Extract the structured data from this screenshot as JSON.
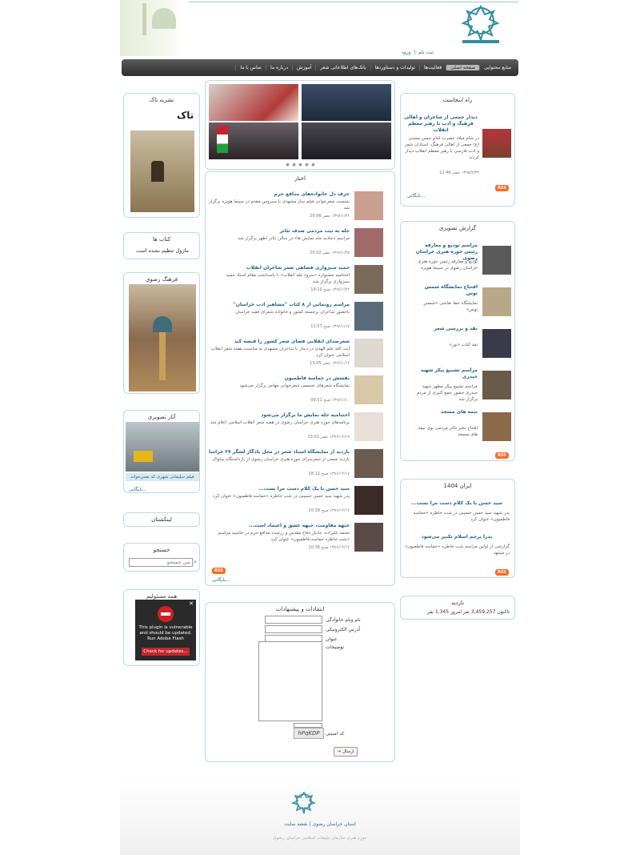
{
  "header": {
    "logo": "logo-icon",
    "login": "ورود",
    "register": "ثبت نام",
    "separator": "|"
  },
  "nav": [
    {
      "label": "منابع محتوایی",
      "active": false
    },
    {
      "label": "صفحه اصلی",
      "active": true
    },
    {
      "label": "فعالیت‌ها",
      "active": false
    },
    {
      "label": "تولیدات و دستاوردها",
      "active": false
    },
    {
      "label": "بانک‌های اطلاعاتی شعر",
      "active": false
    },
    {
      "label": "آموزش",
      "active": false
    },
    {
      "label": "درباره ما",
      "active": false
    },
    {
      "label": "تماس با ما",
      "active": false
    }
  ],
  "left": {
    "nashriyeh_title": "نشریه تاک",
    "books_title": "کتاب ها",
    "books_empty": "ماژول تنظیم نشده است",
    "farhang_title": "فرهنگ رضوی",
    "asar_title": "آثار تصویری",
    "asar_caption": "فیلم سلیمانی شهری که نفس‌خواند",
    "asar_more": "بایگانی...",
    "links_title": "لینکستان",
    "search_title": "جستجو",
    "search_placeholder": "متن جستجو",
    "poll_title": "همه مسئولیم",
    "flash_line1": "This plugin is vulnerable",
    "flash_line2": "and should be updated.",
    "flash_line3": "Run Adobe Flash",
    "flash_button": "Check for updates..."
  },
  "center": {
    "news_title": "اخبار",
    "news": [
      {
        "title": "حرف دل خانواده‌های مدافع حرم",
        "desc": "نشست شعرخوانی فیلم ساز مشهدی با سیروس مقدم در سینما هویزه برگزار شد",
        "date": "۱۳۹۶/۱/۲۶ عصر 20:06"
      },
      {
        "title": "جله به نیت مردمی صدف تئاتر",
        "desc": "مراسم «جاذبه جله نمایش ها» در سالن تئاتر اطهر برگزار شد",
        "date": "۱۳۹۶/۱/۲۵ عصر 20:02"
      },
      {
        "title": "حمید سبزواری فضاهی شعر شاعران انقلاب",
        "desc": "اختتامیه جشنواره «سرود جله انقلاب» با پاسداشت مقام استاد حمید سبزواری برگزار شد",
        "date": "۱۳۹۶/۱/۲۲ صبح 19:10"
      },
      {
        "title": "مراسم رونمایی از ۸ کتاب \"مشاهیر ادب خراسان\"",
        "desc": "باحضور شاعران برجسته کشور و خانواده شعرای فقید خراسان",
        "date": "۱۳۹۶/۱/۱۷ صبح 11:57"
      },
      {
        "title": "شعرصدای انقلابی فضای شعر کشور را قبضه کند",
        "desc": "آیت الله علم الهدی در دیدار با شاعران مشهدی به مناسبت هفته شعر انقلاب اسلامی عنوان کرد",
        "date": "۱۳۹۶/۱/۱۴ عصر 13:05"
      },
      {
        "title": "نقشش در حماسه فاطمیون",
        "desc": "نمایشگاه شعرهای تجسمی شعرخوانی مهاجر برگزار می‌شود",
        "date": "۱۳۹۶/۱/۱۰ صبح 09:51"
      },
      {
        "title": "اختتامیه جله نمایش ما برگزار می‌شود",
        "desc": "برنامه‌های حوزه هنری خراسان رضوی در هفته شعر انقلاب اسلامی اعلام شد",
        "date": "۱۳۹۶/۱۲/۱۹ عصر 13:01"
      },
      {
        "title": "بازدید از نمایشگاه اسناد شعر در محل یادگار لشگر ۲۷ خراسان",
        "desc": "بازدید جمعی از شعرسرای حوزه هنری خراسان رضوی از بازداشتگاه ساواک",
        "date": "۱۳۹۶/۱۲/۱۷ صبح 18:12"
      },
      {
        "title": "سید حسن با یک کلام دست مرا بست...",
        "desc": "پدر شهید سید حسن حسینی در شب خاطره «حماسه فاطمیون» عنوان کرد",
        "date": "۱۳۹۶/۱۲/۱۲ صبح 10:39"
      },
      {
        "title": "جبهه مقاومت، جبهه عشق و اعتماد است...",
        "desc": "محمد علیزاده، جانباز دفاع مقدس و رزمنده مدافع حرم در حاشیه مراسم «شب خاطره حماسه فاطمیون» عنوان کرد",
        "date": "۱۳۹۶/۱۲/۱۲ صبح 10:36"
      }
    ],
    "news_more": "بایگانی...",
    "rss": "RSS",
    "form_title": "انتقادات و پیشنهادات",
    "form_name": "نام ونام خانوادگی",
    "form_email": "آدرس الکترونیکی",
    "form_subject": "عنوان",
    "form_desc": "توضیحات",
    "form_captcha_label": "کد امنیتی",
    "form_captcha": "hPqKDP",
    "form_submit": "ارسال"
  },
  "right": {
    "rah_title": "راه ابنجاست",
    "rah_item_title": "دیدار جمعی از شاعران و اهالی فرهنگ و ادب با رهبر معظم انقلاب",
    "rah_item_desc": "در شام میلاد حضرت امام حسن مجتبی (ع) جمعی از اهالی فرهنگ، استادان شعر و ادب فارسی با رهبر معظم انقلاب دیدار کردند",
    "rah_item_date": "۱۳۹۵/۲/۳۲ عصر 12:46",
    "rah_more": "بایگانی...",
    "gozaresh_title": "گزارش تصویری",
    "gozaresh": [
      {
        "title": "مراسم تودیع و معارفه رئیس حوزه هنری خراسان رضوی",
        "desc": "تودیع و معارفه رئیس حوزه هنری خراسان رضوی در سینما هویزه"
      },
      {
        "title": "افتتاح نمایشگاه شمس توس",
        "desc": "نمایشگاه خط نقاشی «شمس توس»"
      },
      {
        "title": "نقد و بررسی شعر",
        "desc": "نقد کتاب «نور»"
      },
      {
        "title": "مراسم تشییع پیکر شهید حیدری",
        "desc": "مراسم تشییع پیکر مطهر شهید حیدری حضور جمع کثیری از مردم برگزار شد"
      },
      {
        "title": "نیمه های مسجد",
        "desc": "افتتاح دفتر تئاتر مردمی بوی نیمه های مسجد"
      }
    ],
    "iran_title": "ایران 1404",
    "iran_items": [
      {
        "title": "سید حسن با یک کلام دست مرا بست...",
        "desc": "پدر شهید سید حسن حسینی در شب خاطره «حماسه فاطمیون» عنوان کرد"
      },
      {
        "title": "پدرا پرچم اسلام تکبیر می‌شود",
        "desc": "گزارشی از اولین مراسم شب خاطره «حماسه فاطمیون» در مشهد"
      }
    ],
    "visits_title": "بازدید",
    "visits_total_label": "تاکنون",
    "visits_total": "3,459,257",
    "visits_unit": "نفر",
    "visits_today_label": "امروز",
    "visits_today": "1,345"
  },
  "footer": {
    "links": "استان خراسان رضوی | نقشه سایت",
    "copy": "حوزه هنری سازمان تبلیغات اسلامی خراسان رضوی"
  }
}
